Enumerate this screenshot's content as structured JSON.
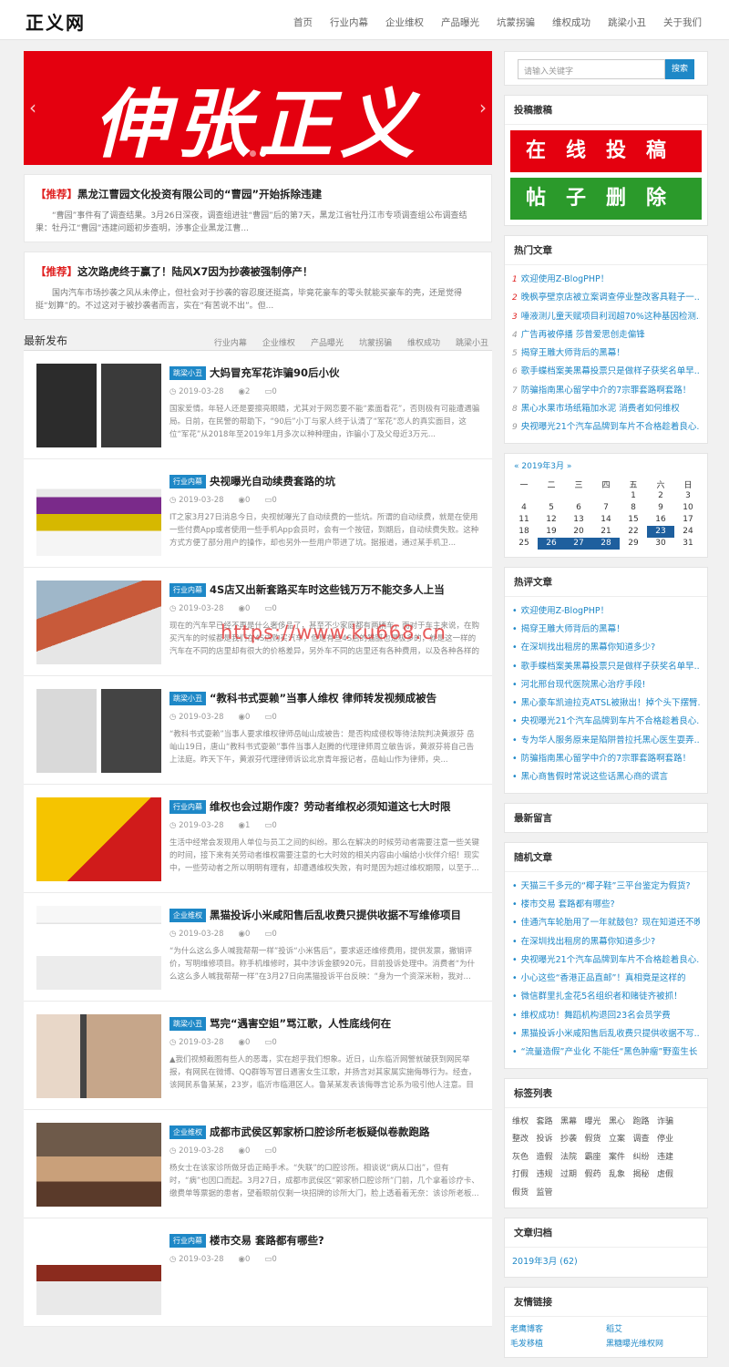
{
  "header": {
    "logo": "正义网",
    "nav": [
      "首页",
      "行业内幕",
      "企业维权",
      "产品曝光",
      "坑蒙拐骗",
      "维权成功",
      "跳梁小丑",
      "关于我们"
    ]
  },
  "banner": {
    "text": "伸张正义",
    "prev": "‹",
    "next": "›"
  },
  "featured": [
    {
      "tag": "【推荐】",
      "title": "黑龙江曹园文化投资有限公司的“曹园”开始拆除违建",
      "desc": "“曹园”事件有了调查结果。3月26日深夜，调查组进驻“曹园”后的第7天，黑龙江省牡丹江市专项调查组公布调查结果：牡丹江“曹园”违建问题初步查明，涉事企业黑龙江曹..."
    },
    {
      "tag": "【推荐】",
      "title": "这次路虎终于赢了！陆风X7因为抄袭被强制停产！",
      "desc": "国内汽车市场抄袭之风从未停止，但社会对于抄袭的容忍度还挺高，毕竟花豪车的零头就能买豪车的壳，还是觉得挺“划算”的。不过这对于被抄袭者而言，实在“有苦说不出”。但..."
    }
  ],
  "latest": {
    "title": "最新发布",
    "cats": [
      "行业内幕",
      "企业维权",
      "产品曝光",
      "坑蒙拐骗",
      "维权成功",
      "跳梁小丑"
    ]
  },
  "posts": [
    {
      "tag": "跳梁小丑",
      "title": "大妈冒充军花诈骗90后小伙",
      "date": "2019-03-28",
      "views": "2",
      "comments": "0",
      "desc": "国家爱情。年轻人还是要擦亮眼睛，尤其对于网恋要不能“素面看花”，否则极有可能遭遇骗局。日前，在民警的帮助下，“90后”小丁与家人终于认清了“军花”恋人的真实面目，这位“军花”从2018年至2019年1月多次以种种理由，诈骗小丁及父母近3万元..."
    },
    {
      "tag": "行业内幕",
      "title": "央视曝光自动续费套路的坑",
      "date": "2019-03-28",
      "views": "0",
      "comments": "0",
      "desc": "IT之家3月27日消息今日，央视就曝光了自动续费的一些坑。所谓的自动续费，就是在使用一些付费App或者使用一些手机App会员时，会有一个按钮，到期后，自动续费失败。这种方式方便了部分用户的操作，却也另外一些用户带进了坑。据报道，通过某手机卫..."
    },
    {
      "tag": "行业内幕",
      "title": "4S店又出新套路买车时这些钱万万不能交多人上当",
      "date": "2019-03-28",
      "views": "0",
      "comments": "0",
      "desc": "现在的汽车早已经不再是什么奢侈品了，甚至不少家庭都有两辆车，而对于车主来说，在购买汽车的时候都是我们在4S店购买汽车，但是有些4S店的猫腻也是极多的，就是这一样的汽车在不同的店里却有很大的价格差异，另外车不同的店里还有各种费用，以及各种各样的收费项目..."
    },
    {
      "tag": "跳梁小丑",
      "title": "“教科书式耍赖”当事人维权 律师转发视频成被告",
      "date": "2019-03-28",
      "views": "0",
      "comments": "0",
      "desc": "“教科书式耍赖”当事人要求维权律师岳屾山成被告：是否构成侵权等待法院判决黄淑芬 岳屾山19日，唐山“教科书式耍赖”事件当事人赵腾的代理律师周立敏告诉，黄淑芬将自己告上法庭。昨天下午，黄淑芬代理律师诉讼北京青年报记者，岳屾山作为律师，央..."
    },
    {
      "tag": "行业内幕",
      "title": "维权也会过期作废？劳动者维权必须知道这七大时限",
      "date": "2019-03-28",
      "views": "1",
      "comments": "0",
      "desc": "生活中经常会发现用人单位与员工之间的纠纷。那么在解决的时候劳动者需要注意一些关键的时间，接下来有关劳动者维权需要注意的七大时效的相关内容由小编给小伙伴介绍！现实中，一些劳动者之所以明明有理有，却遭遇维权失败，有时是因为超过维权期限，以至于..."
    },
    {
      "tag": "企业维权",
      "title": "黑猫投诉小米咸阳售后乱收费只提供收据不写维修项目",
      "date": "2019-03-28",
      "views": "0",
      "comments": "0",
      "desc": "“为什么这么多人喊我帮帮一样”投诉“小米售后”，要求返还维修费用，提供发票，撤销评价，写明维修项目。称手机维修时，其中涉诉金额920元，目前投诉处理中。消费者“为什么这么多人喊我帮帮一样”在3月27日向黑猫投诉平台反映：“身为一个资深米粉，我对..."
    },
    {
      "tag": "跳梁小丑",
      "title": "骂完“遇害空姐”骂江歌，人性底线何在",
      "date": "2019-03-28",
      "views": "0",
      "comments": "0",
      "desc": "▲我们视频截图有些人的恶毒，实在超乎我们想象。近日，山东临沂网警就破获到网民举报，有网民在微博、QQ群等写冒日遇害女生江歌，并扬言对其家属实施侮辱行为。经查，该网民系鲁某某，23岁，临沂市临港区人。鲁某某发表该侮辱言论系为吸引他人注意。目前，..."
    },
    {
      "tag": "企业维权",
      "title": "成都市武侯区郭家桥口腔诊所老板疑似卷款跑路",
      "date": "2019-03-28",
      "views": "0",
      "comments": "0",
      "desc": "杨女士在该家诊所做牙齿正畸手术。“失联”的口腔诊所。相谈说“病从口出”，但有时，“病”也因口而起。3月27日，成都市武侯区“郭家桥口腔诊所”门前，几个拿着诊疗卡、缴费单等票据的患者，望着眼前仅剩一块招牌的诊所大门，脸上透着着无奈：该诊所老板..."
    },
    {
      "tag": "行业内幕",
      "title": "楼市交易 套路都有哪些?",
      "date": "2019-03-28",
      "views": "0",
      "comments": "0",
      "desc": ""
    }
  ],
  "search": {
    "placeholder": "请输入关键字",
    "button": "搜索"
  },
  "submit": {
    "title": "投稿撤稿",
    "btn1": "在线投稿",
    "btn2": "帖子删除"
  },
  "hot": {
    "title": "热门文章",
    "items": [
      "欢迎使用Z-BlogPHP！",
      "晚枫亭壁京店被立案调查停业整改客具鞋子一...",
      "唾液测儿童天赋项目利润超70%这种基因检测...",
      "广告再被停播 莎普爱思创走偏锋",
      "揭穿王雕大师背后的黑幕！",
      "歌手蝶档案美黑幕投票只是做样子获奖名单早...",
      "防骗指南黑心留学中介的7宗罪套路啊套路！",
      "黑心水果市场纸箱加水泥 消费者如何维权",
      "央视曝光21个汽车品牌到车片不合格趁着良心..."
    ]
  },
  "calendar": {
    "prev": "«",
    "month": "2019年3月",
    "next": "»",
    "weekdays": [
      "一",
      "二",
      "三",
      "四",
      "五",
      "六",
      "日"
    ],
    "weeks": [
      [
        "",
        "",
        "",
        "",
        "1",
        "2",
        "3"
      ],
      [
        "4",
        "5",
        "6",
        "7",
        "8",
        "9",
        "10"
      ],
      [
        "11",
        "12",
        "13",
        "14",
        "15",
        "16",
        "17"
      ],
      [
        "18",
        "19",
        "20",
        "21",
        "22",
        "23",
        "24"
      ],
      [
        "25",
        "26",
        "27",
        "28",
        "29",
        "30",
        "31"
      ]
    ],
    "highlighted": [
      "23",
      "26",
      "27",
      "28"
    ]
  },
  "hotcomment": {
    "title": "热评文章",
    "items": [
      "欢迎使用Z-BlogPHP！",
      "揭穿王雕大师背后的黑幕！",
      "在深圳找出租房的黑幕你知道多少?",
      "歌手蝶档案美黑幕投票只是做样子获奖名单早...",
      "河北邢台现代医院黑心治疗手段!",
      "黑心豪车凯迪拉克ATSL被揪出！掉个头下摆臂...",
      "央视曝光21个汽车品牌到车片不合格趁着良心...",
      "专为华人服务原来是陷阱普拉托黑心医生耍弄...",
      "防骗指南黑心留学中介的7宗罪套路啊套路！",
      "黑心商售假时常说这些话黑心商的谎言"
    ]
  },
  "latestcomments": {
    "title": "最新留言"
  },
  "random": {
    "title": "随机文章",
    "items": [
      "天猫三千多元的“椰子鞋”三平台鉴定为假货?",
      "楼市交易 套路都有哪些?",
      "佳通汽车轮胎用了一年就鼓包？现在知道还不晚",
      "在深圳找出租房的黑幕你知道多少?",
      "央视曝光21个汽车品牌到车片不合格趁着良心...",
      "小心这些“香港正品直邮”！真相竟是这样的",
      "微信群里扎金花5名组织者和赌徒齐被抓！",
      "维权成功！舞蹈机构退回23名会员学费",
      "黑猫投诉小米咸阳售后乱收费只提供收据不写...",
      "“流量造假”产业化 不能任“黑色肿瘤”野蛮生长"
    ]
  },
  "tagcloud": {
    "title": "标签列表",
    "tags": [
      "维权",
      "套路",
      "黑幕",
      "曝光",
      "黑心",
      "跑路",
      "诈骗",
      "整改",
      "投诉",
      "抄袭",
      "假货",
      "立案",
      "调查",
      "停业",
      "灰色",
      "造假",
      "法院",
      "霸座",
      "案件",
      "纠纷",
      "违建",
      "打假",
      "违规",
      "过期",
      "假药",
      "乱象",
      "揭秘",
      "虐假",
      "假货",
      "监管"
    ]
  },
  "archive": {
    "title": "文章归档",
    "items": [
      "2019年3月 (62)"
    ]
  },
  "friendlinks": {
    "title": "友情链接",
    "items": [
      "老鹰博客",
      "稻艾",
      "毛发移植",
      "黑糖曝光维权网"
    ]
  },
  "watermark": "https://www.ku668.cn"
}
